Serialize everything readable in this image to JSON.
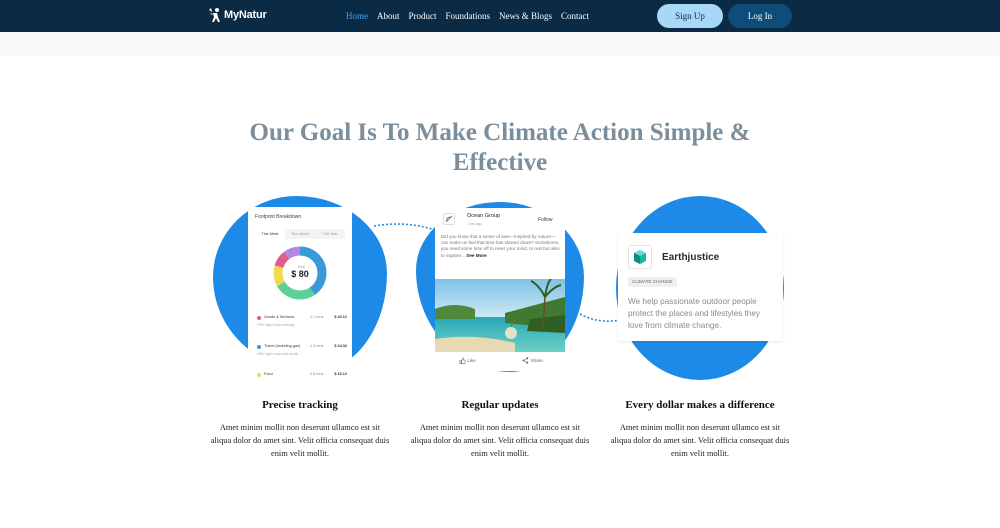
{
  "header": {
    "brand": "MyNatur",
    "nav": [
      {
        "label": "Home",
        "active": true
      },
      {
        "label": "About",
        "active": false
      },
      {
        "label": "Product",
        "active": false
      },
      {
        "label": "Foundations",
        "active": false
      },
      {
        "label": "News & Blogs",
        "active": false
      },
      {
        "label": "Contact",
        "active": false
      }
    ],
    "signup_label": "Sign Up",
    "login_label": "Log In"
  },
  "main": {
    "headline": "Our Goal Is To Make Climate Action Simple & Effective"
  },
  "footprint_card": {
    "title": "Footprint Breakdown",
    "tabs": [
      "This Week",
      "This Month",
      "This Year"
    ],
    "total_label": "Total",
    "total": "$ 80",
    "rows": [
      {
        "name": "Goods & Services",
        "tons": "2.1 tons",
        "value": "$ 40.12",
        "sub": "23% higher than average",
        "color": "#e05c8a"
      },
      {
        "name": "Travel (including gas)",
        "tons": "1.3 tons",
        "value": "$ 24.32",
        "sub": "28% higher than last month",
        "color": "#3a9ad9"
      },
      {
        "name": "Food",
        "tons": "0.8 tons",
        "value": "$ 16.12",
        "sub": "",
        "color": "#f2d94e"
      }
    ]
  },
  "post_card": {
    "group": "Ocean Group",
    "time": "1 hrs ago",
    "follow": "Follow",
    "body": "Did you know that a sense of awe—inspired by nature—can make us feel that time has slowed down? Sometimes, you need some time off to reset your mind, to rest but also to explore...",
    "see_more": "See More",
    "like": "Like",
    "share": "Share"
  },
  "org_card": {
    "name": "Earthjustice",
    "tag": "CLIMATE CHANGE",
    "desc": "We help passionate outdoor people protect the places and lifestyles they love from climate change."
  },
  "features": [
    {
      "title": "Precise tracking",
      "desc": "Amet minim mollit non deserunt ullamco est sit aliqua dolor do amet sint. Velit officia consequat duis enim velit mollit."
    },
    {
      "title": "Regular updates",
      "desc": "Amet minim mollit non deserunt ullamco est sit aliqua dolor do amet sint. Velit officia consequat duis enim velit mollit."
    },
    {
      "title": "Every dollar makes a difference",
      "desc": "Amet minim mollit non deserunt ullamco est sit aliqua dolor do amet sint. Velit officia consequat duis enim velit mollit."
    }
  ],
  "colors": {
    "navbar": "#0b2b45",
    "accent": "#1e8ae7",
    "nav_active": "#3da5ff",
    "headline": "#7a8e9c"
  }
}
